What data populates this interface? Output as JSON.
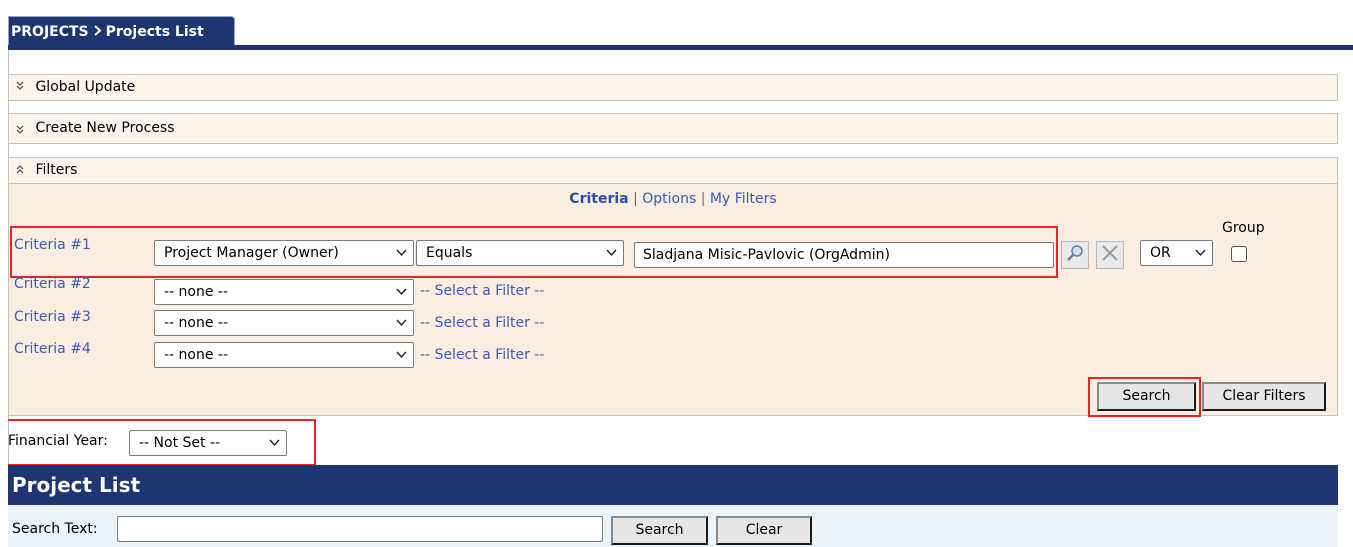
{
  "breadcrumb": {
    "section": "PROJECTS",
    "separator_icon": "chevron-right-icon",
    "page": "Projects List"
  },
  "sections": {
    "global_update": {
      "label": "Global Update",
      "icon": "chevron-double-down-icon"
    },
    "create_process": {
      "label": "Create New Process",
      "icon": "chevron-double-down-icon"
    },
    "filters": {
      "label": "Filters",
      "icon": "chevron-double-up-icon"
    }
  },
  "filter_tabs": {
    "criteria": "Criteria",
    "sep1": "|",
    "options": "Options",
    "sep2": "|",
    "my_filters": "My Filters"
  },
  "criteria": [
    {
      "label": "Criteria #1",
      "field": "Project Manager (Owner)",
      "operator": "Equals",
      "value": "Sladjana Misic-Pavlovic (OrgAdmin)",
      "logic": "OR"
    },
    {
      "label": "Criteria #2",
      "field": "-- none --",
      "hint": "-- Select a Filter --"
    },
    {
      "label": "Criteria #3",
      "field": "-- none --",
      "hint": "-- Select a Filter --"
    },
    {
      "label": "Criteria #4",
      "field": "-- none --",
      "hint": "-- Select a Filter --"
    }
  ],
  "group_label": "Group",
  "buttons": {
    "search": "Search",
    "clear_filters": "Clear Filters",
    "list_search": "Search",
    "list_clear": "Clear"
  },
  "financial_year": {
    "label": "Financial Year:",
    "value": "-- Not Set --"
  },
  "project_list": {
    "title": "Project List",
    "search_label": "Search Text:",
    "search_value": ""
  },
  "colors": {
    "header_navy": "#1e3570",
    "panel_beige": "#faeee3",
    "link_blue": "#3a5bb5",
    "highlight_red": "#e5252a"
  }
}
